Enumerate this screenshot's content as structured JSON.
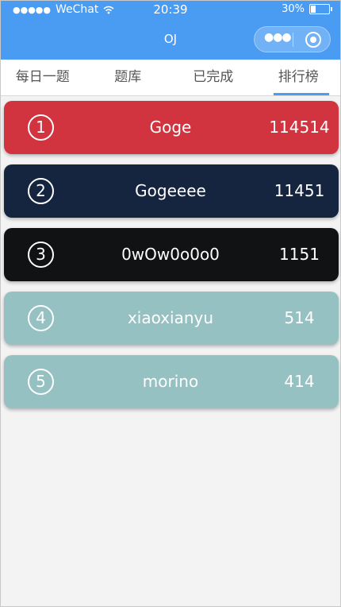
{
  "status_bar": {
    "carrier_dots": "●●●●●",
    "carrier": "WeChat",
    "time": "20:39",
    "battery": "30%",
    "battery_level": 0.3
  },
  "nav": {
    "title": "OJ"
  },
  "tabs": [
    {
      "label": "每日一题"
    },
    {
      "label": "题库"
    },
    {
      "label": "已完成"
    },
    {
      "label": "排行榜",
      "active": true
    }
  ],
  "ranking": [
    {
      "rank": "1",
      "name": "Goge",
      "score": "114514",
      "color": "#d1343f"
    },
    {
      "rank": "2",
      "name": "Gogeeee",
      "score": "11451",
      "color": "#16253f"
    },
    {
      "rank": "3",
      "name": "0wOw0o0o0",
      "score": "1151",
      "color": "#111214"
    },
    {
      "rank": "4",
      "name": "xiaoxianyu",
      "score": "514",
      "color": "#95c1c2"
    },
    {
      "rank": "5",
      "name": "morino",
      "score": "414",
      "color": "#95c1c2"
    }
  ],
  "colors": {
    "accent": "#4a9cf3",
    "background": "#f3f3f3"
  }
}
